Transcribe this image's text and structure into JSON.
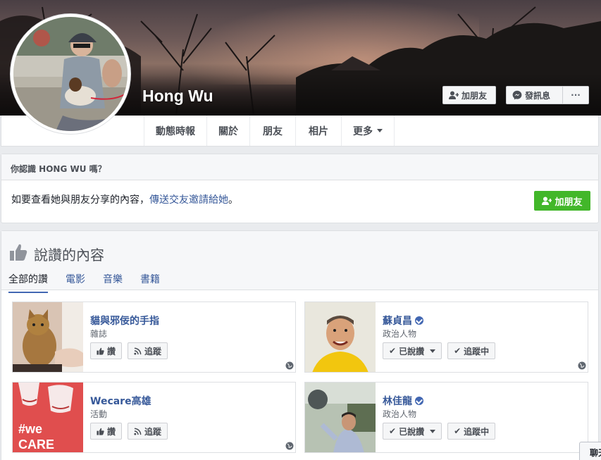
{
  "profile": {
    "name": "Hong Wu"
  },
  "cover_actions": {
    "add_friend": "加朋友",
    "message": "發訊息",
    "more": "···"
  },
  "tabs": [
    {
      "label": "動態時報"
    },
    {
      "label": "關於"
    },
    {
      "label": "朋友"
    },
    {
      "label": "相片"
    },
    {
      "label": "更多"
    }
  ],
  "know_box": {
    "header": "你認識 HONG WU 嗎？",
    "text_before": "如要查看她與朋友分享的內容，",
    "link": "傳送交友邀請給她",
    "text_after": "。",
    "button": "加朋友"
  },
  "likes": {
    "title": "說讚的內容",
    "tabs": [
      "全部的讚",
      "電影",
      "音樂",
      "書籍"
    ],
    "active_tab": "全部的讚",
    "cards": [
      {
        "title": "貓與邪佞的手指",
        "category": "雜誌",
        "verified": false,
        "like_label": "讚",
        "follow_label": "追蹤",
        "liked": false
      },
      {
        "title": "蘇貞昌",
        "category": "政治人物",
        "verified": true,
        "like_label": "已說讚",
        "follow_label": "追蹤中",
        "liked": true
      },
      {
        "title": "Wecare高雄",
        "category": "活動",
        "verified": false,
        "like_label": "讚",
        "follow_label": "追蹤",
        "liked": false
      },
      {
        "title": "林佳龍",
        "category": "政治人物",
        "verified": true,
        "like_label": "已說讚",
        "follow_label": "追蹤中",
        "liked": true
      }
    ],
    "wecare_logo_text": [
      "#we",
      "CARE"
    ]
  },
  "chat": {
    "label": "聊天"
  },
  "colors": {
    "link_blue": "#365899",
    "brand_blue": "#4267b2",
    "green": "#42b72a",
    "wecare_red": "#e04e4e"
  }
}
